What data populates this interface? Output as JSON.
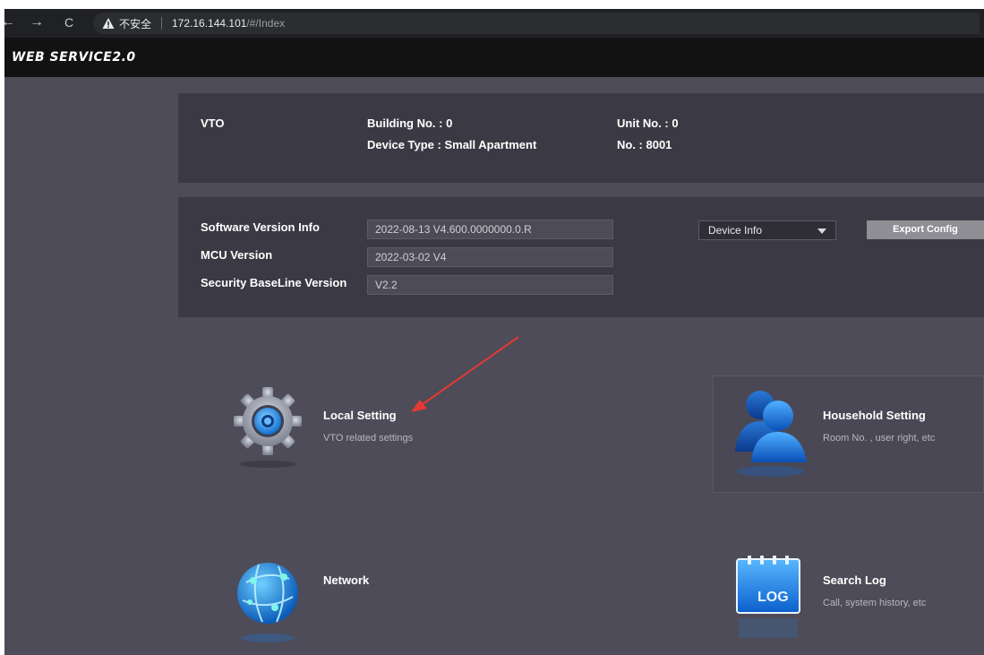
{
  "browser": {
    "back_glyph": "←",
    "forward_glyph": "→",
    "reload_glyph": "C",
    "security_label": "不安全",
    "url_host": "172.16.144.101",
    "url_path": "/#/Index"
  },
  "app": {
    "logo": "WEB SERVICE2.0"
  },
  "device_panel": {
    "device_name": "VTO",
    "building_no": "Building No. : 0",
    "device_type": "Device Type : Small Apartment",
    "unit_no": "Unit No. : 0",
    "no": "No. : 8001"
  },
  "version_panel": {
    "rows": [
      {
        "label": "Software Version Info",
        "value": "2022-08-13 V4.600.0000000.0.R"
      },
      {
        "label": "MCU Version",
        "value": "2022-03-02 V4"
      },
      {
        "label": "Security BaseLine Version",
        "value": "V2.2"
      }
    ],
    "select_value": "Device Info",
    "export_label": "Export Config"
  },
  "tiles": {
    "local": {
      "title": "Local Setting",
      "subtitle": "VTO related settings",
      "icon": "gear-icon"
    },
    "household": {
      "title": "Household Setting",
      "subtitle": "Room No. , user right, etc",
      "icon": "users-icon"
    },
    "network": {
      "title": "Network",
      "subtitle": "",
      "icon": "globe-icon"
    },
    "log": {
      "title": "Search Log",
      "subtitle": "Call, system history, etc",
      "icon": "log-icon",
      "icon_text": "LOG"
    }
  },
  "colors": {
    "background": "#4e4c58",
    "panel": "#3b3a44",
    "header": "#121212",
    "annotation_arrow": "#e53935"
  }
}
